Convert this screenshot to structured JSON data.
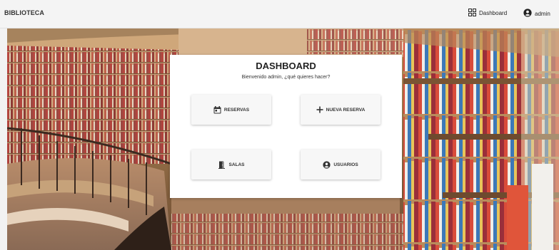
{
  "app": {
    "brand": "BIBLIOTECA"
  },
  "nav": {
    "dashboard": {
      "label": "Dashboard",
      "icon": "dashboard-grid-icon"
    },
    "user": {
      "label": "admin",
      "icon": "account-circle-icon"
    }
  },
  "dashboard": {
    "title": "DASHBOARD",
    "subtitle": "Bienvenido admin, ¿qué quieres hacer?",
    "buttons": [
      {
        "label": "RESERVAS",
        "icon": "calendar-icon"
      },
      {
        "label": "NUEVA RESERVA",
        "icon": "plus-icon"
      },
      {
        "label": "SALAS",
        "icon": "door-icon"
      },
      {
        "label": "USUARIOS",
        "icon": "account-circle-icon"
      }
    ]
  },
  "colors": {
    "topbar": "#f4f4f4",
    "card": "#ffffff",
    "text": "#333333"
  }
}
